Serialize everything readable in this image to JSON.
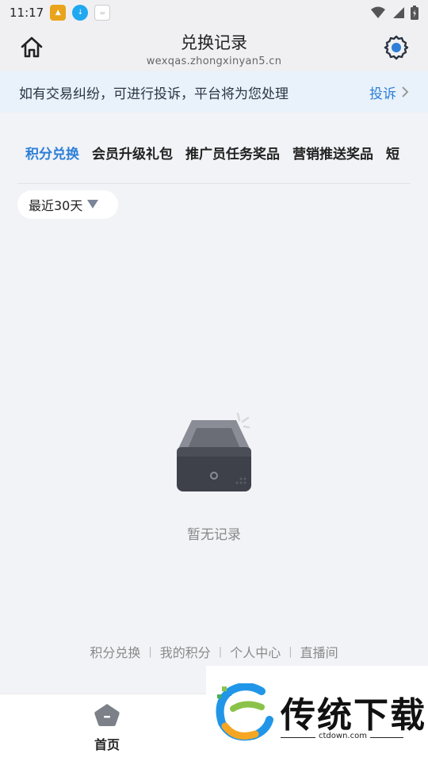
{
  "status_bar": {
    "time": "11:17",
    "left_icons": [
      "app-icon-1",
      "download-icon",
      "app-icon-3"
    ],
    "right_icons": [
      "wifi-icon",
      "signal-icon",
      "battery-icon"
    ]
  },
  "header": {
    "title": "兑换记录",
    "subtitle": "wexqas.zhongxinyan5.cn",
    "home_icon": "home-icon",
    "settings_icon": "gear-icon"
  },
  "notice": {
    "text": "如有交易纠纷，可进行投诉，平台将为您处理",
    "action_label": "投诉",
    "accent_color": "#2d7fd8",
    "background_color": "#e9f2fb"
  },
  "tabs": [
    {
      "label": "积分兑换",
      "active": true
    },
    {
      "label": "会员升级礼包",
      "active": false
    },
    {
      "label": "推广员任务奖品",
      "active": false
    },
    {
      "label": "营销推送奖品",
      "active": false
    },
    {
      "label": "短",
      "active": false
    }
  ],
  "filter": {
    "label": "最近30天",
    "icon": "triangle-down-icon"
  },
  "empty_state": {
    "icon": "empty-inbox-icon",
    "text": "暂无记录"
  },
  "footer_links": [
    "积分兑换",
    "我的积分",
    "个人中心",
    "直播间"
  ],
  "footer_separator": "|",
  "bottom_nav": {
    "home_label": "首页",
    "home_icon": "home-pentagon-icon"
  },
  "watermark": {
    "text": "传统下载",
    "url": "ctdown.com"
  }
}
